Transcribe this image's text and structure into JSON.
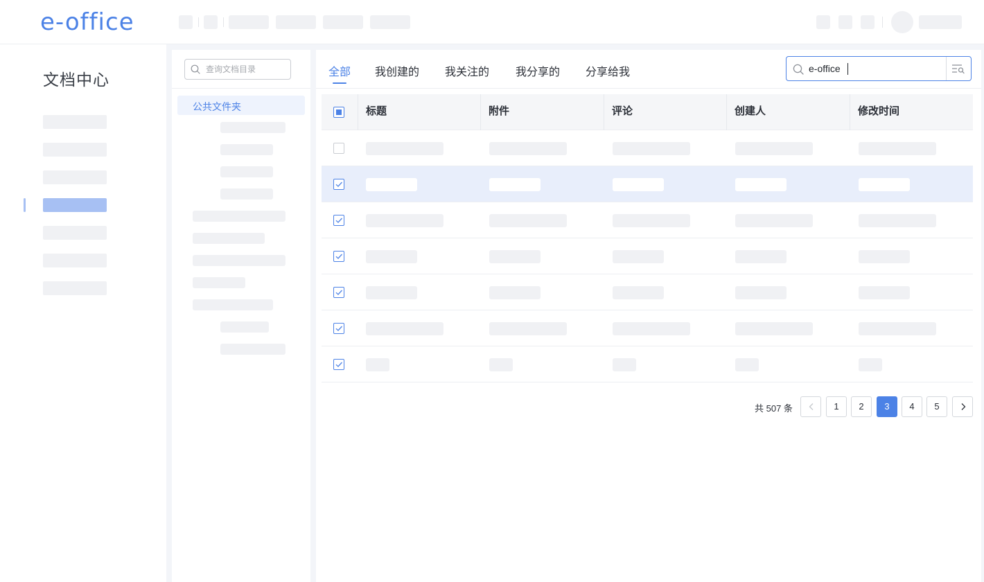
{
  "app": {
    "logo": "e-office"
  },
  "sidebar": {
    "title": "文档中心"
  },
  "tree": {
    "search_placeholder": "查询文档目录",
    "root_folder": "公共文件夹"
  },
  "tabs": [
    {
      "label": "全部",
      "active": true
    },
    {
      "label": "我创建的",
      "active": false
    },
    {
      "label": "我关注的",
      "active": false
    },
    {
      "label": "我分享的",
      "active": false
    },
    {
      "label": "分享给我",
      "active": false
    }
  ],
  "search": {
    "value": "e-office"
  },
  "table": {
    "columns": [
      "标题",
      "附件",
      "评论",
      "创建人",
      "修改时间"
    ],
    "select_all_state": "indeterminate",
    "rows": [
      {
        "checked": false,
        "selected": false
      },
      {
        "checked": true,
        "selected": true
      },
      {
        "checked": true,
        "selected": false
      },
      {
        "checked": true,
        "selected": false
      },
      {
        "checked": true,
        "selected": false
      },
      {
        "checked": true,
        "selected": false
      },
      {
        "checked": true,
        "selected": false
      }
    ]
  },
  "pagination": {
    "total_text": "共 507 条",
    "pages": [
      "1",
      "2",
      "3",
      "4",
      "5"
    ],
    "current_page": "3"
  },
  "colors": {
    "accent": "#4c82e6",
    "selected_row": "#e8eefb"
  }
}
